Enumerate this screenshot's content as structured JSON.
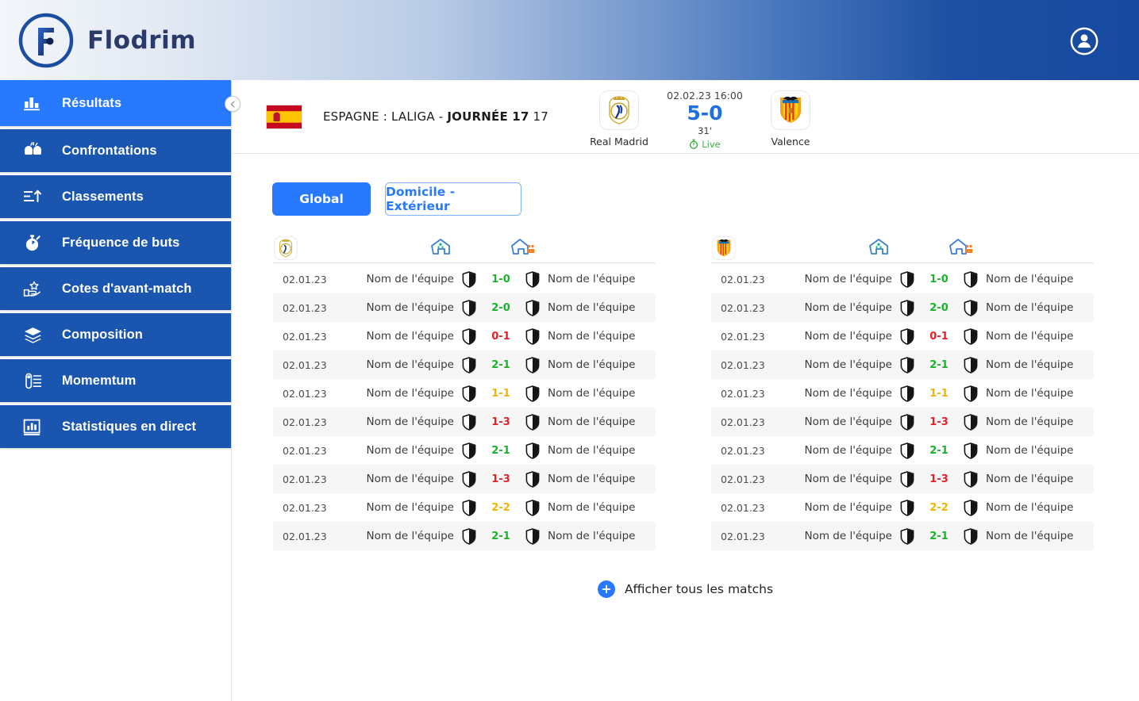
{
  "brand": {
    "name": "Flodrim",
    "logo_icon": "flodrim-circle-f-logo"
  },
  "header": {
    "account_icon": "account-circle-icon"
  },
  "sidebar": {
    "collapse_icon": "chevron-left-icon",
    "items": [
      {
        "label": "Résultats",
        "icon": "bar-chart-icon",
        "active": true
      },
      {
        "label": "Confrontations",
        "icon": "boxing-gloves-icon",
        "active": false
      },
      {
        "label": "Classements",
        "icon": "ranking-arrow-up-icon",
        "active": false
      },
      {
        "label": "Fréquence de buts",
        "icon": "stopwatch-icon",
        "active": false
      },
      {
        "label": "Cotes d'avant-match",
        "icon": "hand-star-odds-icon",
        "active": false
      },
      {
        "label": "Composition",
        "icon": "layers-icon",
        "active": false
      },
      {
        "label": "Momemtum",
        "icon": "momentum-gauge-icon",
        "active": false
      },
      {
        "label": "Statistiques en direct",
        "icon": "live-stats-chart-icon",
        "active": false
      }
    ]
  },
  "match": {
    "flag_icon": "spain-flag-icon",
    "league_prefix": "ESPAGNE : LALIGA - ",
    "league_round": "JOURNÉE 17",
    "home": {
      "name": "Real Madrid",
      "crest_icon": "real-madrid-crest-icon"
    },
    "away": {
      "name": "Valence",
      "crest_icon": "valencia-crest-icon"
    },
    "date": "02.02.23  16:00",
    "score": "5-0",
    "minute": "31'",
    "live_label": "Live",
    "live_icon": "stopwatch-live-icon",
    "live_color": "#3cb043",
    "score_color": "#1f6fe0"
  },
  "tabs": [
    {
      "label": "Global",
      "active": true
    },
    {
      "label": "Domicile - Extérieur",
      "active": false
    }
  ],
  "colors": {
    "accent": "#2979ff",
    "sidebar_item": "#1a56b0",
    "win": "#19b22a",
    "loss": "#ec1c24",
    "draw": "#f0b400",
    "header_gradient_start": "#f3f6fa",
    "header_gradient_end": "#17499f"
  },
  "panels": [
    {
      "crest_icon": "real-madrid-crest-icon",
      "home_icon": "home-green-icon",
      "away_icon": "away-orange-icon",
      "rows": [
        {
          "date": "02.01.23",
          "home_team": "Nom de l'équipe",
          "away_team": "Nom de l'équipe",
          "score": "1-0",
          "result": "win"
        },
        {
          "date": "02.01.23",
          "home_team": "Nom de l'équipe",
          "away_team": "Nom de l'équipe",
          "score": "2-0",
          "result": "win"
        },
        {
          "date": "02.01.23",
          "home_team": "Nom de l'équipe",
          "away_team": "Nom de l'équipe",
          "score": "0-1",
          "result": "loss"
        },
        {
          "date": "02.01.23",
          "home_team": "Nom de l'équipe",
          "away_team": "Nom de l'équipe",
          "score": "2-1",
          "result": "win"
        },
        {
          "date": "02.01.23",
          "home_team": "Nom de l'équipe",
          "away_team": "Nom de l'équipe",
          "score": "1-1",
          "result": "draw"
        },
        {
          "date": "02.01.23",
          "home_team": "Nom de l'équipe",
          "away_team": "Nom de l'équipe",
          "score": "1-3",
          "result": "loss"
        },
        {
          "date": "02.01.23",
          "home_team": "Nom de l'équipe",
          "away_team": "Nom de l'équipe",
          "score": "2-1",
          "result": "win"
        },
        {
          "date": "02.01.23",
          "home_team": "Nom de l'équipe",
          "away_team": "Nom de l'équipe",
          "score": "1-3",
          "result": "loss"
        },
        {
          "date": "02.01.23",
          "home_team": "Nom de l'équipe",
          "away_team": "Nom de l'équipe",
          "score": "2-2",
          "result": "draw"
        },
        {
          "date": "02.01.23",
          "home_team": "Nom de l'équipe",
          "away_team": "Nom de l'équipe",
          "score": "2-1",
          "result": "win"
        }
      ]
    },
    {
      "crest_icon": "valencia-crest-icon",
      "home_icon": "home-green-icon",
      "away_icon": "away-orange-icon",
      "rows": [
        {
          "date": "02.01.23",
          "home_team": "Nom de l'équipe",
          "away_team": "Nom de l'équipe",
          "score": "1-0",
          "result": "win"
        },
        {
          "date": "02.01.23",
          "home_team": "Nom de l'équipe",
          "away_team": "Nom de l'équipe",
          "score": "2-0",
          "result": "win"
        },
        {
          "date": "02.01.23",
          "home_team": "Nom de l'équipe",
          "away_team": "Nom de l'équipe",
          "score": "0-1",
          "result": "loss"
        },
        {
          "date": "02.01.23",
          "home_team": "Nom de l'équipe",
          "away_team": "Nom de l'équipe",
          "score": "2-1",
          "result": "win"
        },
        {
          "date": "02.01.23",
          "home_team": "Nom de l'équipe",
          "away_team": "Nom de l'équipe",
          "score": "1-1",
          "result": "draw"
        },
        {
          "date": "02.01.23",
          "home_team": "Nom de l'équipe",
          "away_team": "Nom de l'équipe",
          "score": "1-3",
          "result": "loss"
        },
        {
          "date": "02.01.23",
          "home_team": "Nom de l'équipe",
          "away_team": "Nom de l'équipe",
          "score": "2-1",
          "result": "win"
        },
        {
          "date": "02.01.23",
          "home_team": "Nom de l'équipe",
          "away_team": "Nom de l'équipe",
          "score": "1-3",
          "result": "loss"
        },
        {
          "date": "02.01.23",
          "home_team": "Nom de l'équipe",
          "away_team": "Nom de l'équipe",
          "score": "2-2",
          "result": "draw"
        },
        {
          "date": "02.01.23",
          "home_team": "Nom de l'équipe",
          "away_team": "Nom de l'équipe",
          "score": "2-1",
          "result": "win"
        }
      ]
    }
  ],
  "footer": {
    "show_all_label": "Afficher tous les matchs",
    "plus_icon": "plus-icon",
    "plus_glyph": "+"
  }
}
